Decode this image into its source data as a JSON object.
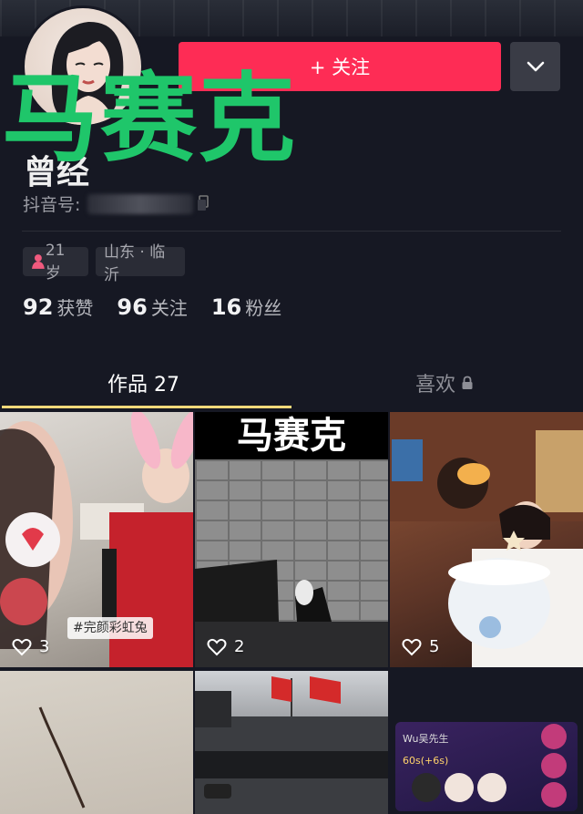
{
  "profile": {
    "nickname": "曾经",
    "douyin_id_label": "抖音号:",
    "watermark": "马赛克"
  },
  "actions": {
    "follow_label": "+ 关注",
    "more_icon": "chevron-down-icon"
  },
  "tags": {
    "age": "21岁",
    "location": "山东 · 临沂"
  },
  "stats": [
    {
      "value": "92",
      "label": "获赞"
    },
    {
      "value": "96",
      "label": "关注"
    },
    {
      "value": "16",
      "label": "粉丝"
    }
  ],
  "tabs": {
    "works": "作品 27",
    "likes": "喜欢"
  },
  "videos": [
    {
      "likes": "3",
      "caption": "#完颜彩虹兔"
    },
    {
      "likes": "2",
      "title": "马赛克"
    },
    {
      "likes": "5"
    },
    {
      "likes": ""
    },
    {
      "likes": ""
    },
    {
      "likes": "",
      "live_user": "Wu吴先生",
      "live_badge": "60s(+6s)"
    }
  ],
  "colors": {
    "background": "#161823",
    "follow": "#fe2c55",
    "tab_indicator": "#f4d97a",
    "watermark": "#1fc66a"
  }
}
